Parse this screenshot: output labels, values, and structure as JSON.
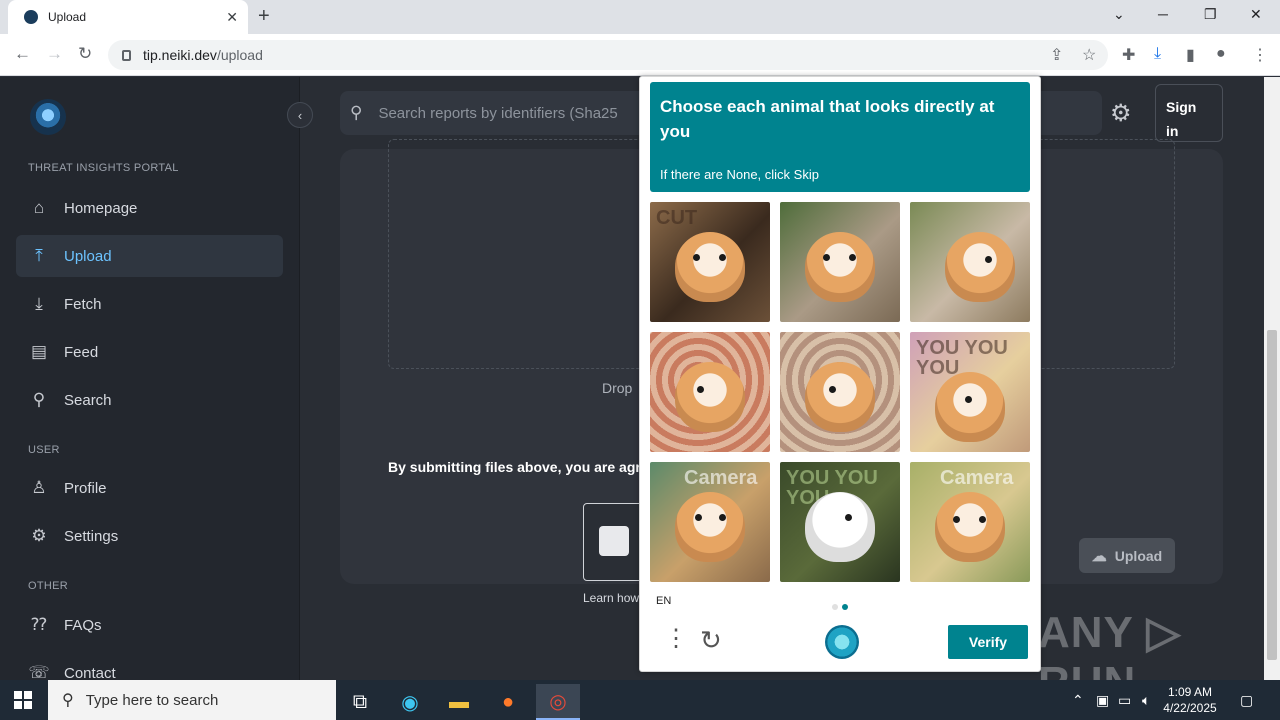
{
  "browser": {
    "tab_title": "Upload",
    "url_host": "tip.neiki.dev",
    "url_path": "/upload"
  },
  "sidebar": {
    "section_portal": "THREAT INSIGHTS PORTAL",
    "items": [
      {
        "label": "Homepage",
        "icon": "home-icon"
      },
      {
        "label": "Upload",
        "icon": "upload-icon",
        "active": true
      },
      {
        "label": "Fetch",
        "icon": "download-icon"
      },
      {
        "label": "Feed",
        "icon": "feed-icon"
      },
      {
        "label": "Search",
        "icon": "search-icon"
      }
    ],
    "section_user": "USER",
    "user_items": [
      {
        "label": "Profile",
        "icon": "profile-icon"
      },
      {
        "label": "Settings",
        "icon": "gear-icon"
      }
    ],
    "section_other": "OTHER",
    "other_items": [
      {
        "label": "FAQs",
        "icon": "faq-icon"
      },
      {
        "label": "Contact",
        "icon": "contact-icon"
      }
    ]
  },
  "header": {
    "search_placeholder": "Search reports by identifiers (Sha25",
    "signin_label": "Sign in"
  },
  "upload": {
    "drop_text": "Drop",
    "agree_text": "By submitting files above, you are agre",
    "learn_text": "Learn how",
    "upload_button": "Upload"
  },
  "captcha": {
    "title": "Choose each animal that looks directly at you",
    "subtitle": "If there are None, click Skip",
    "language": "EN",
    "verify_label": "Verify",
    "images": [
      {
        "overlay": "CUT"
      },
      {
        "overlay": ""
      },
      {
        "overlay": ""
      },
      {
        "overlay": ""
      },
      {
        "overlay": ""
      },
      {
        "overlay": "YOU YOU YOU"
      },
      {
        "overlay": "Camera"
      },
      {
        "overlay": "YOU YOU YOU"
      },
      {
        "overlay": "Camera"
      }
    ]
  },
  "watermark": "ANY ▷ RUN",
  "taskbar": {
    "search_placeholder": "Type here to search",
    "time": "1:09 AM",
    "date": "4/22/2025"
  }
}
